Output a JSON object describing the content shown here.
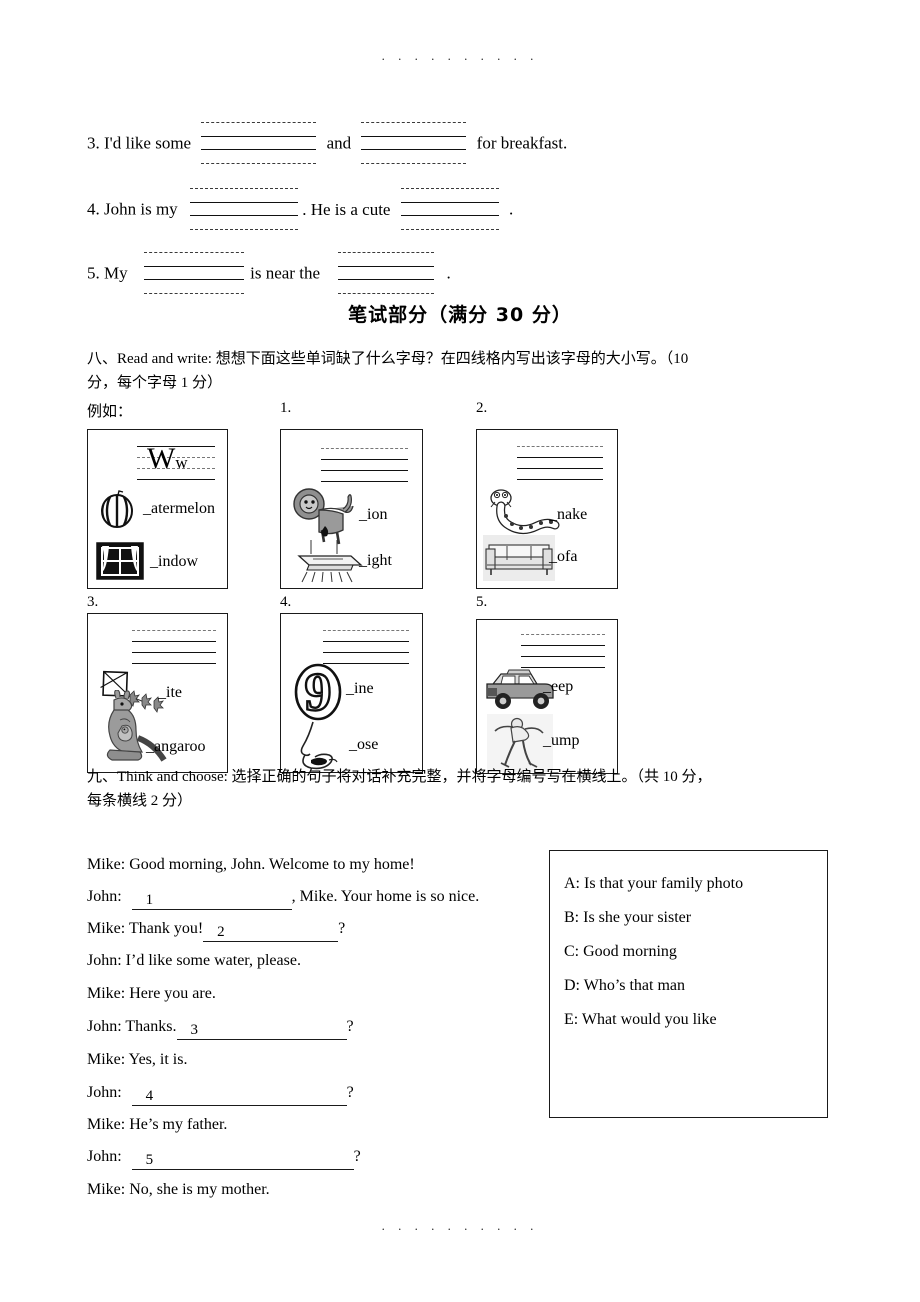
{
  "markers": {
    "top": ". . . . . . . . . .",
    "bottom": ". . . . . . . . . ."
  },
  "fill_sentences": [
    {
      "num": "3.",
      "before": "3. I'd like some",
      "middle": "and",
      "after": "for breakfast."
    },
    {
      "num": "4.",
      "before": "4. John is my",
      "middle": ". He is a cute",
      "after": "."
    },
    {
      "num": "5.",
      "before": "5. My",
      "middle": "is near the",
      "after": "."
    }
  ],
  "written_section": {
    "title": "笔试部分（满分 30 分）"
  },
  "section8": {
    "label": "八、Read and write:",
    "instruction_line1": "八、Read and write: 想想下面这些单词缺了什么字母？在四线格内写出该字母的大小写。（10",
    "instruction_line2": "分，每个字母 1 分）",
    "example_label": "例如：",
    "boxes": [
      {
        "number": "",
        "is_example": true,
        "letter": "Ww",
        "letter_upper": "W",
        "letter_lower": "w",
        "items": [
          {
            "picture": "watermelon-icon",
            "word": "_atermelon"
          },
          {
            "picture": "window-icon",
            "word": "_indow"
          }
        ]
      },
      {
        "number": "1.",
        "is_example": false,
        "letter": "",
        "items": [
          {
            "picture": "lion-icon",
            "word": "_ion"
          },
          {
            "picture": "light-icon",
            "word": "_ight"
          }
        ]
      },
      {
        "number": "2.",
        "is_example": false,
        "letter": "",
        "items": [
          {
            "picture": "snake-icon",
            "word": "_nake"
          },
          {
            "picture": "sofa-icon",
            "word": "_ofa"
          }
        ]
      },
      {
        "number": "3.",
        "is_example": false,
        "letter": "",
        "items": [
          {
            "picture": "kite-icon",
            "word": "_ite"
          },
          {
            "picture": "kangaroo-icon",
            "word": "_angaroo"
          }
        ]
      },
      {
        "number": "4.",
        "is_example": false,
        "letter": "",
        "items": [
          {
            "picture": "nine-icon",
            "word": "_ine"
          },
          {
            "picture": "nose-icon",
            "word": "_ose"
          }
        ]
      },
      {
        "number": "5.",
        "is_example": false,
        "letter": "",
        "items": [
          {
            "picture": "jeep-icon",
            "word": "_eep"
          },
          {
            "picture": "jump-icon",
            "word": "_ump"
          }
        ]
      }
    ]
  },
  "section9": {
    "instruction_line1": "九、Think and choose: 选择正确的句子将对话补充完整，并将字母编号写在横线上。（共 10 分，",
    "instruction_line2": "每条横线 2 分）",
    "dialogue": [
      {
        "speaker": "Mike:",
        "text": "Good morning, John. Welcome to my home!",
        "blank": "",
        "tail": ""
      },
      {
        "speaker": "John:",
        "text": "",
        "blank": "1",
        "tail": ", Mike. Your home is so nice."
      },
      {
        "speaker": "Mike:",
        "text": "Thank you!",
        "blank": "2",
        "tail": "?"
      },
      {
        "speaker": "John:",
        "text": "I’d like some water, please.",
        "blank": "",
        "tail": ""
      },
      {
        "speaker": "Mike:",
        "text": "Here you are.",
        "blank": "",
        "tail": ""
      },
      {
        "speaker": "John:",
        "text": "Thanks.",
        "blank": "3",
        "tail": "?"
      },
      {
        "speaker": "Mike:",
        "text": "Yes, it is.",
        "blank": "",
        "tail": ""
      },
      {
        "speaker": "John:",
        "text": "",
        "blank": "4",
        "tail": "?"
      },
      {
        "speaker": "Mike:",
        "text": "He’s my father.",
        "blank": "",
        "tail": ""
      },
      {
        "speaker": "John:",
        "text": "",
        "blank": "5",
        "tail": "?"
      },
      {
        "speaker": "Mike:",
        "text": "No, she is my mother.",
        "blank": "",
        "tail": ""
      }
    ],
    "options": [
      "A: Is that your family photo",
      "B: Is she your sister",
      "C: Good morning",
      "D: Who’s that man",
      "E: What would you like"
    ]
  }
}
